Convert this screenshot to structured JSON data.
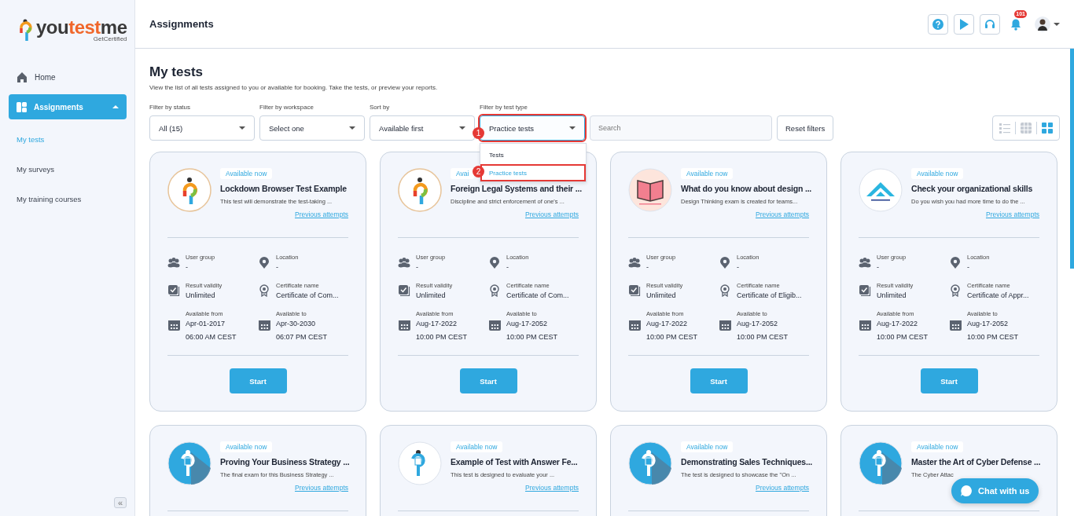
{
  "logo": {
    "parts": [
      "you",
      "test",
      "me"
    ],
    "tagline": "GetCertified"
  },
  "sidebar": {
    "items": [
      {
        "label": "Home",
        "kind": "home",
        "selected": false
      },
      {
        "label": "Assignments",
        "kind": "group",
        "selected": true,
        "expanded": true,
        "children": [
          {
            "label": "My tests",
            "selected": true
          },
          {
            "label": "My surveys",
            "selected": false
          },
          {
            "label": "My training courses",
            "selected": false
          }
        ]
      }
    ],
    "collapse": "«"
  },
  "header": {
    "title": "Assignments",
    "notifications": "101"
  },
  "page": {
    "title": "My tests",
    "subtitle": "View the list of all tests assigned to you or available for booking. Take the tests, or preview your reports."
  },
  "filters": [
    {
      "label": "Filter by status",
      "value": "All (15)",
      "highlighted": false
    },
    {
      "label": "Filter by workspace",
      "value": "Select one",
      "highlighted": false
    },
    {
      "label": "Sort by",
      "value": "Available first",
      "highlighted": false
    },
    {
      "label": "Filter by test type",
      "value": "Practice tests",
      "highlighted": true,
      "step": "1",
      "expanded": true,
      "options": [
        {
          "label": "Tests",
          "selected": false
        },
        {
          "label": "Practice tests",
          "selected": true,
          "step": "2"
        }
      ]
    }
  ],
  "search": {
    "placeholder": "Search"
  },
  "reset_button": "Reset filters",
  "views": [
    {
      "kind": "list",
      "selected": false
    },
    {
      "kind": "table",
      "selected": false
    },
    {
      "kind": "grid",
      "selected": true
    }
  ],
  "cards": [
    {
      "kind": "logo",
      "status": "Available now",
      "title": "Lockdown Browser Test Example",
      "description": "This test will demonstrate the test-taking ...",
      "link": "Previous attempts",
      "button": "Start",
      "fields": [
        {
          "label": "User group",
          "value": "-"
        },
        {
          "label": "Location",
          "value": "-"
        },
        {
          "label": "Result validity",
          "value": "Unlimited"
        },
        {
          "label": "Certificate name",
          "value": "Certificate of Com..."
        },
        {
          "label": "Available from",
          "value": "Apr-01-2017",
          "time": "06:00 AM CEST"
        },
        {
          "label": "Available to",
          "value": "Apr-30-2030",
          "time": "06:07 PM CEST"
        }
      ]
    },
    {
      "kind": "logo",
      "status": "Avai",
      "title": "Foreign Legal Systems and their ...",
      "description": "Discipline and strict enforcement of one's ...",
      "link": "Previous attempts",
      "button": "Start",
      "fields": [
        {
          "label": "User group",
          "value": "-"
        },
        {
          "label": "Location",
          "value": "-"
        },
        {
          "label": "Result validity",
          "value": "Unlimited"
        },
        {
          "label": "Certificate name",
          "value": "Certificate of Com..."
        },
        {
          "label": "Available from",
          "value": "Aug-17-2022",
          "time": "10:00 PM CEST"
        },
        {
          "label": "Available to",
          "value": "Aug-17-2052",
          "time": "10:00 PM CEST"
        }
      ]
    },
    {
      "kind": "book",
      "status": "Available now",
      "title": "What do you know about design ...",
      "description": "Design Thinking exam is created for teams...",
      "link": "Previous attempts",
      "button": "Start",
      "fields": [
        {
          "label": "User group",
          "value": "-"
        },
        {
          "label": "Location",
          "value": "-"
        },
        {
          "label": "Result validity",
          "value": "Unlimited"
        },
        {
          "label": "Certificate name",
          "value": "Certificate of Eligib..."
        },
        {
          "label": "Available from",
          "value": "Aug-17-2022",
          "time": "10:00 PM CEST"
        },
        {
          "label": "Available to",
          "value": "Aug-17-2052",
          "time": "10:00 PM CEST"
        }
      ]
    },
    {
      "kind": "roof",
      "status": "Available now",
      "title": "Check your organizational skills",
      "description": "Do you wish you had more time to do the ...",
      "link": "Previous attempts",
      "button": "Start",
      "fields": [
        {
          "label": "User group",
          "value": "-"
        },
        {
          "label": "Location",
          "value": "-"
        },
        {
          "label": "Result validity",
          "value": "Unlimited"
        },
        {
          "label": "Certificate name",
          "value": "Certificate of Appr..."
        },
        {
          "label": "Available from",
          "value": "Aug-17-2022",
          "time": "10:00 PM CEST"
        },
        {
          "label": "Available to",
          "value": "Aug-17-2052",
          "time": "10:00 PM CEST"
        }
      ]
    },
    {
      "kind": "person-blue",
      "status": "Available now",
      "title": "Proving Your Business Strategy ...",
      "description": "The final exam for this Business Strategy ...",
      "link": "Previous attempts"
    },
    {
      "kind": "person-white",
      "status": "Available now",
      "title": "Example of Test with Answer Fe...",
      "description": "This test is designed to evaluate your ...",
      "link": "Previous attempts"
    },
    {
      "kind": "person-blue",
      "status": "Available now",
      "title": "Demonstrating Sales Techniques...",
      "description": "The test is designed to showcase the \"On ...",
      "link": "Previous attempts"
    },
    {
      "kind": "person-blue",
      "status": "Available now",
      "title": "Master the Art of Cyber Defense ...",
      "description": "The Cyber Attac"
    }
  ],
  "chat": {
    "label": "Chat with us"
  }
}
